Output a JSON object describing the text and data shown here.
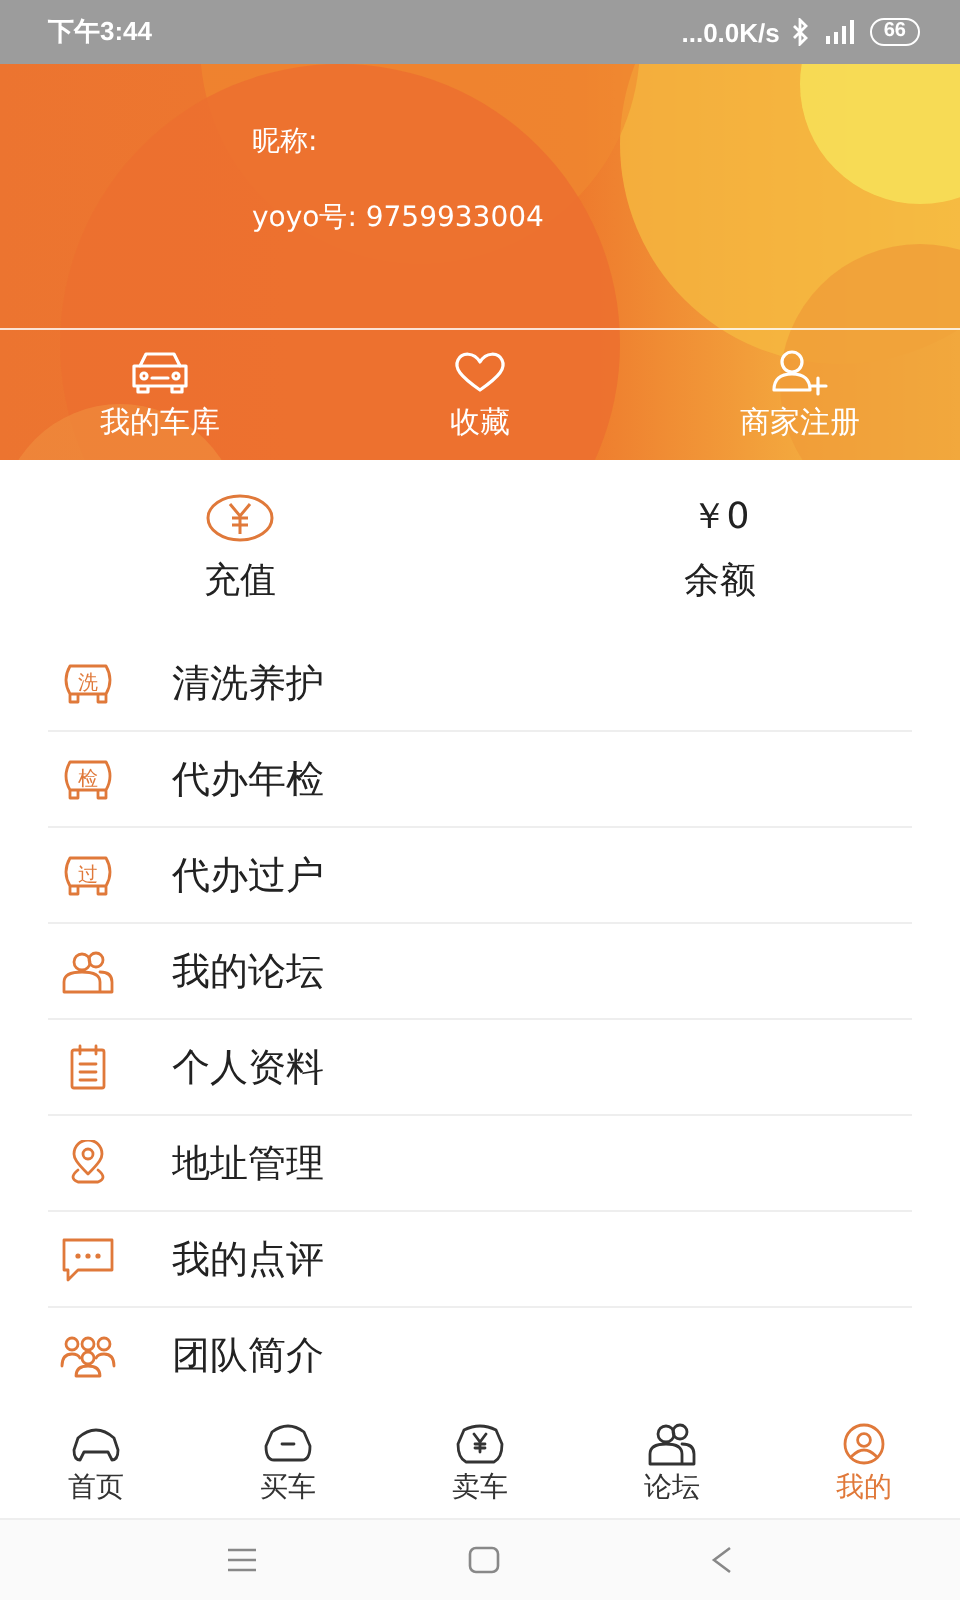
{
  "status_bar": {
    "time": "下午3:44",
    "network_speed": "...0.0K/s",
    "battery": "66"
  },
  "profile": {
    "nickname_label": "昵称:",
    "id_label": "yoyo号: 9759933004"
  },
  "shortcuts": [
    {
      "kind": "car",
      "label": "我的车库"
    },
    {
      "kind": "heart",
      "label": "收藏"
    },
    {
      "kind": "add-user",
      "label": "商家注册"
    }
  ],
  "wallet": {
    "recharge_label": "充值",
    "balance_amount": "￥0",
    "balance_label": "余额"
  },
  "menu": [
    {
      "kind": "badge",
      "badge": "洗",
      "label": "清洗养护"
    },
    {
      "kind": "badge",
      "badge": "检",
      "label": "代办年检"
    },
    {
      "kind": "badge",
      "badge": "过",
      "label": "代办过户"
    },
    {
      "kind": "people",
      "label": "我的论坛"
    },
    {
      "kind": "notepad",
      "label": "个人资料"
    },
    {
      "kind": "pin",
      "label": "地址管理"
    },
    {
      "kind": "chat",
      "label": "我的点评"
    },
    {
      "kind": "team",
      "label": "团队简介"
    }
  ],
  "tabs": [
    {
      "kind": "home",
      "label": "首页",
      "selected": false
    },
    {
      "kind": "buy",
      "label": "买车",
      "selected": false
    },
    {
      "kind": "sell",
      "label": "卖车",
      "selected": false
    },
    {
      "kind": "forum",
      "label": "论坛",
      "selected": false
    },
    {
      "kind": "me",
      "label": "我的",
      "selected": true
    }
  ]
}
